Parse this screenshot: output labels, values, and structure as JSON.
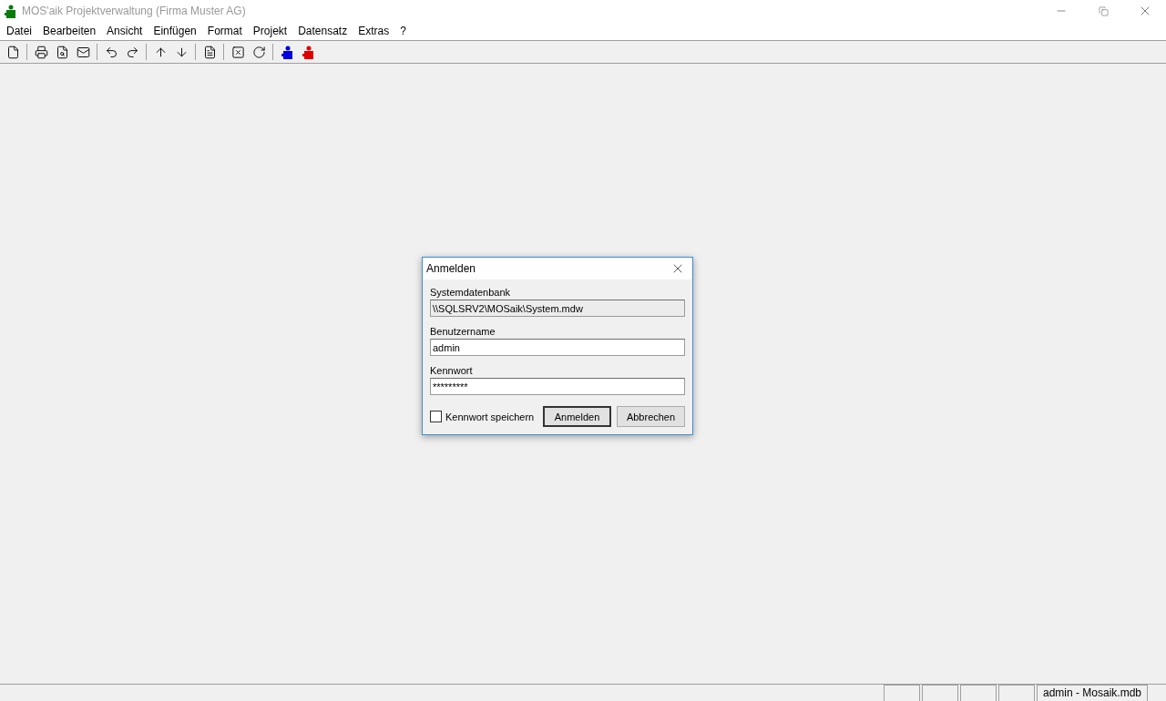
{
  "window": {
    "title": "MOS'aik Projektverwaltung (Firma Muster AG)"
  },
  "menu": [
    "Datei",
    "Bearbeiten",
    "Ansicht",
    "Einfügen",
    "Format",
    "Projekt",
    "Datensatz",
    "Extras",
    "?"
  ],
  "dialog": {
    "title": "Anmelden",
    "fields": [
      {
        "label": "Systemdatenbank",
        "value": "\\\\SQLSRV2\\MOSaik\\System.mdw",
        "disabled": true
      },
      {
        "label": "Benutzername",
        "value": "admin",
        "disabled": false
      },
      {
        "label": "Kennwort",
        "value": "*********",
        "disabled": false
      }
    ],
    "checkbox": {
      "label": "Kennwort speichern",
      "checked": false
    },
    "buttons": [
      {
        "label": "Anmelden",
        "default": true
      },
      {
        "label": "Abbrechen",
        "default": false
      }
    ]
  },
  "status_bar": {
    "text": "admin - Mosaik.mdb"
  }
}
